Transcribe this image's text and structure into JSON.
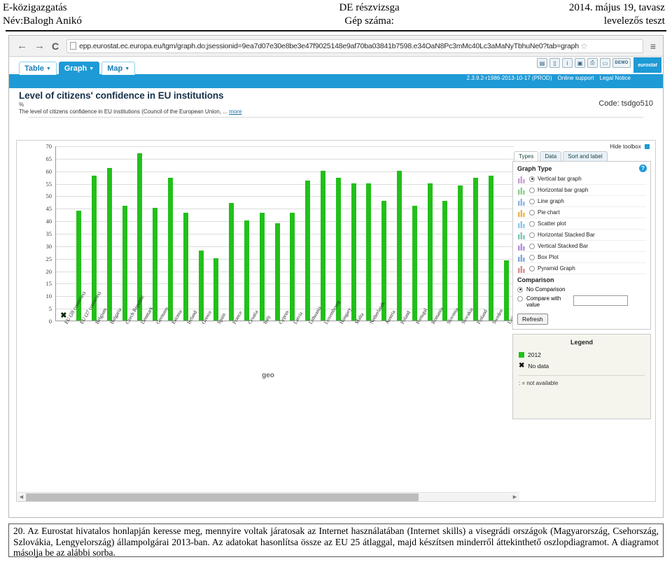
{
  "exam_header": {
    "left_line1": "E-közigazgatás",
    "left_line2": "Név:Balogh Anikó",
    "mid_line1": "DE részvizsga",
    "mid_line2": "Gép száma:",
    "right_line1": "2014. május 19, tavasz",
    "right_line2": "levelezős teszt"
  },
  "browser": {
    "back_icon": "←",
    "forward_icon": "→",
    "reload_icon": "C",
    "url": "epp.eurostat.ec.europa.eu/tgm/graph.do;jsessionid=9ea7d07e30e8be3e47f9025148e9af70ba03841b7598.e34OaN8Pc3mMc40Lc3aMaNyTbhuNe0?tab=graph",
    "star_icon": "☆",
    "menu_icon": "≡"
  },
  "tgm": {
    "tabs": [
      {
        "label": "Table",
        "active": false
      },
      {
        "label": "Graph",
        "active": true
      },
      {
        "label": "Map",
        "active": false
      }
    ],
    "tool_icons": [
      "export-icon",
      "page-icon",
      "info-icon",
      "save-icon",
      "print-icon",
      "new-page-icon"
    ],
    "demo_label": "DEMO",
    "logo_label": "eurostat",
    "version_text": "2.3.9.2-r1986-2013-10-17 (PROD)",
    "online_support": "Online support",
    "legal_notice": "Legal Notice",
    "dataset_title": "Level of citizens' confidence in EU institutions",
    "dataset_unit": "%",
    "dataset_desc": "The level of citizens confidence in EU institutions (Council of the European Union, ...",
    "more_link": "more",
    "code_label": "Code: tsdgo510"
  },
  "chart_data": {
    "type": "bar",
    "title": "Level of citizens' confidence in EU institutions",
    "xlabel": "geo",
    "ylabel": "%",
    "ylim": [
      0,
      70
    ],
    "yticks": [
      0,
      5,
      10,
      15,
      20,
      25,
      30,
      35,
      40,
      45,
      50,
      55,
      60,
      65,
      70
    ],
    "grid": true,
    "series_name": "2012",
    "bar_color": "#22c01a",
    "categories": [
      "EU (28 countries)",
      "EU (27 countries)",
      "Belgium",
      "Bulgaria",
      "Czech Republic",
      "Denmark",
      "Germany",
      "Estonia",
      "Ireland",
      "Greece",
      "Spain",
      "France",
      "Croatia",
      "Italy",
      "Cyprus",
      "Latvia",
      "Lithuania",
      "Luxembourg",
      "Hungary",
      "Malta",
      "Netherlands",
      "Austria",
      "Poland",
      "Portugal",
      "Romania",
      "Slovenia",
      "Slovakia",
      "Finland",
      "Sweden",
      "United Kingdom"
    ],
    "values": [
      null,
      44,
      58,
      61,
      46,
      67,
      45,
      57,
      43,
      28,
      25,
      47,
      40,
      43,
      39,
      43,
      56,
      60,
      57,
      55,
      55,
      48,
      60,
      46,
      55,
      48,
      54,
      57,
      58,
      24
    ]
  },
  "toolbox": {
    "hide_toolbox": "Hide toolbox",
    "tabs": [
      {
        "label": "Types",
        "active": true
      },
      {
        "label": "Data",
        "active": false
      },
      {
        "label": "Sort and label",
        "active": false
      }
    ],
    "help_icon": "?",
    "graph_type_title": "Graph Type",
    "graph_types": [
      {
        "label": "Vertical bar graph",
        "selected": true
      },
      {
        "label": "Horizontal bar graph",
        "selected": false
      },
      {
        "label": "Line graph",
        "selected": false
      },
      {
        "label": "Pie chart",
        "selected": false
      },
      {
        "label": "Scatter plot",
        "selected": false
      },
      {
        "label": "Horizontal Stacked Bar",
        "selected": false
      },
      {
        "label": "Vertical Stacked Bar",
        "selected": false
      },
      {
        "label": "Box Plot",
        "selected": false
      },
      {
        "label": "Pyramid Graph",
        "selected": false
      }
    ],
    "comparison_title": "Comparison",
    "no_comparison": "No Comparison",
    "compare_with_value": "Compare with value",
    "compare_input_value": "",
    "refresh_label": "Refresh",
    "legend_title": "Legend",
    "legend_year": "2012",
    "legend_nodata": "No data",
    "legend_note": ": = not available"
  },
  "task": {
    "text": "20.  Az Eurostat hivatalos honlapján keresse meg, mennyire voltak járatosak az Internet használatában (Internet skills) a visegrádi országok (Magyarország, Csehország, Szlovákia, Lengyelország) állampolgárai 2013-ban. Az adatokat hasonlítsa össze az EU 25 átlaggal, majd készítsen minderről áttekinthető oszlopdiagramot. A diagramot másolja be az alábbi sorba."
  }
}
